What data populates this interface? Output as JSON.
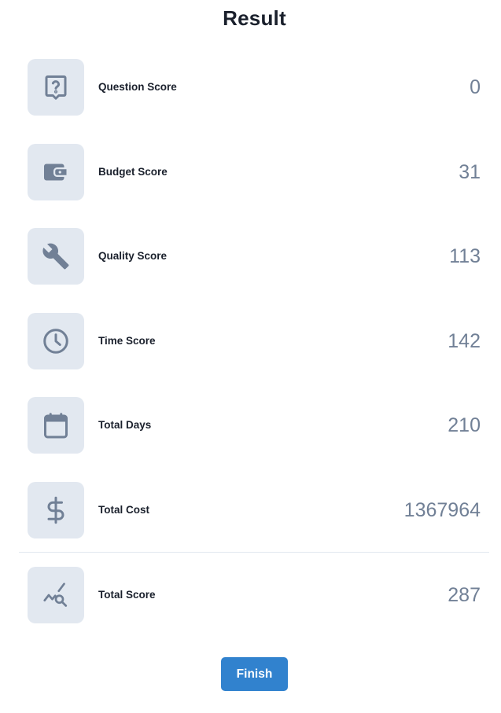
{
  "page": {
    "title": "Result"
  },
  "rows": [
    {
      "label": "Question Score",
      "value": "0",
      "icon": "question-icon"
    },
    {
      "label": "Budget Score",
      "value": "31",
      "icon": "wallet-icon"
    },
    {
      "label": "Quality Score",
      "value": "113",
      "icon": "wrench-icon"
    },
    {
      "label": "Time Score",
      "value": "142",
      "icon": "clock-icon"
    },
    {
      "label": "Total Days",
      "value": "210",
      "icon": "calendar-icon"
    },
    {
      "label": "Total Cost",
      "value": "1367964",
      "icon": "dollar-icon"
    },
    {
      "label": "Total Score",
      "value": "287",
      "icon": "chart-search-icon"
    }
  ],
  "actions": {
    "finish_label": "Finish"
  },
  "colors": {
    "icon": "#718096",
    "icon_bg": "#e2e8f0",
    "value": "#718096",
    "button": "#3182ce"
  }
}
